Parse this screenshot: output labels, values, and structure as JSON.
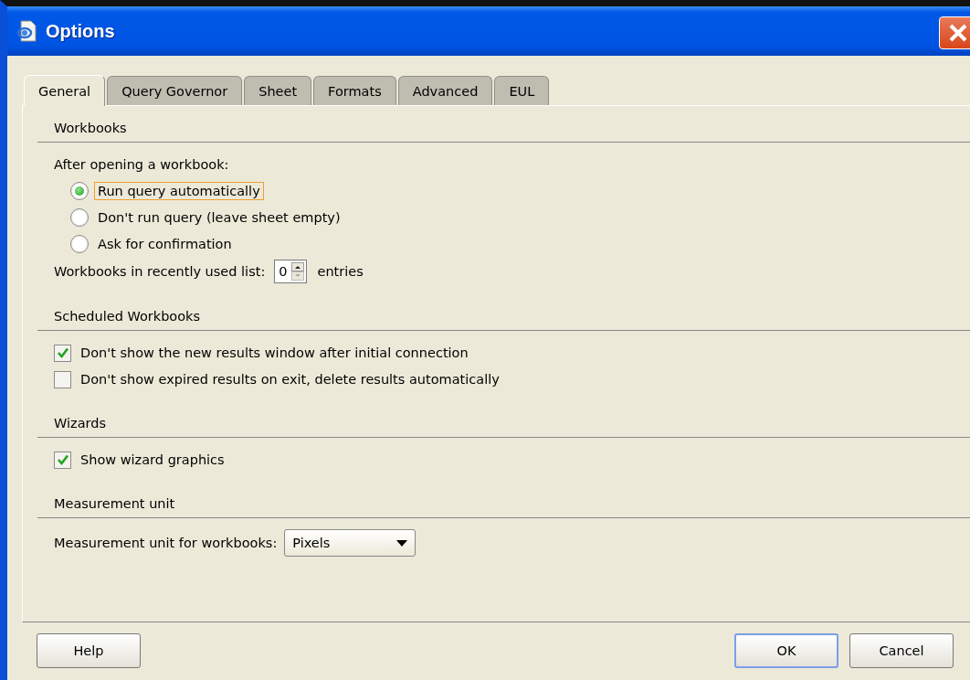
{
  "window": {
    "title": "Options"
  },
  "tabs": [
    {
      "label": "General",
      "selected": true
    },
    {
      "label": "Query Governor",
      "selected": false
    },
    {
      "label": "Sheet",
      "selected": false
    },
    {
      "label": "Formats",
      "selected": false
    },
    {
      "label": "Advanced",
      "selected": false
    },
    {
      "label": "EUL",
      "selected": false
    }
  ],
  "sections": [
    {
      "title": "Workbooks",
      "items": [
        {
          "kind": "caption",
          "label": "After opening a workbook:"
        },
        {
          "kind": "radio",
          "label": "Run query automatically",
          "selected": true,
          "focused": true
        },
        {
          "kind": "radio",
          "label": "Don't run query (leave sheet empty)",
          "selected": false,
          "focused": false
        },
        {
          "kind": "radio",
          "label": "Ask for confirmation",
          "selected": false,
          "focused": false
        },
        {
          "kind": "spinner",
          "label": "Workbooks in recently used list:",
          "value": "0",
          "suffix": "entries"
        }
      ]
    },
    {
      "title": "Scheduled Workbooks",
      "items": [
        {
          "kind": "checkbox",
          "label": "Don't show the new results window after initial connection",
          "checked": true
        },
        {
          "kind": "checkbox",
          "label": "Don't show expired results on exit, delete results automatically",
          "checked": false
        }
      ]
    },
    {
      "title": "Wizards",
      "items": [
        {
          "kind": "checkbox",
          "label": "Show wizard graphics",
          "checked": true
        }
      ]
    },
    {
      "title": "Measurement unit",
      "items": [
        {
          "kind": "dropdown",
          "label": "Measurement unit for workbooks:",
          "value": "Pixels"
        }
      ]
    }
  ],
  "buttons": [
    {
      "label": "Help",
      "kind": "left",
      "default": false
    },
    {
      "label": "OK",
      "kind": "right",
      "default": true
    },
    {
      "label": "Cancel",
      "kind": "right",
      "default": false
    }
  ]
}
